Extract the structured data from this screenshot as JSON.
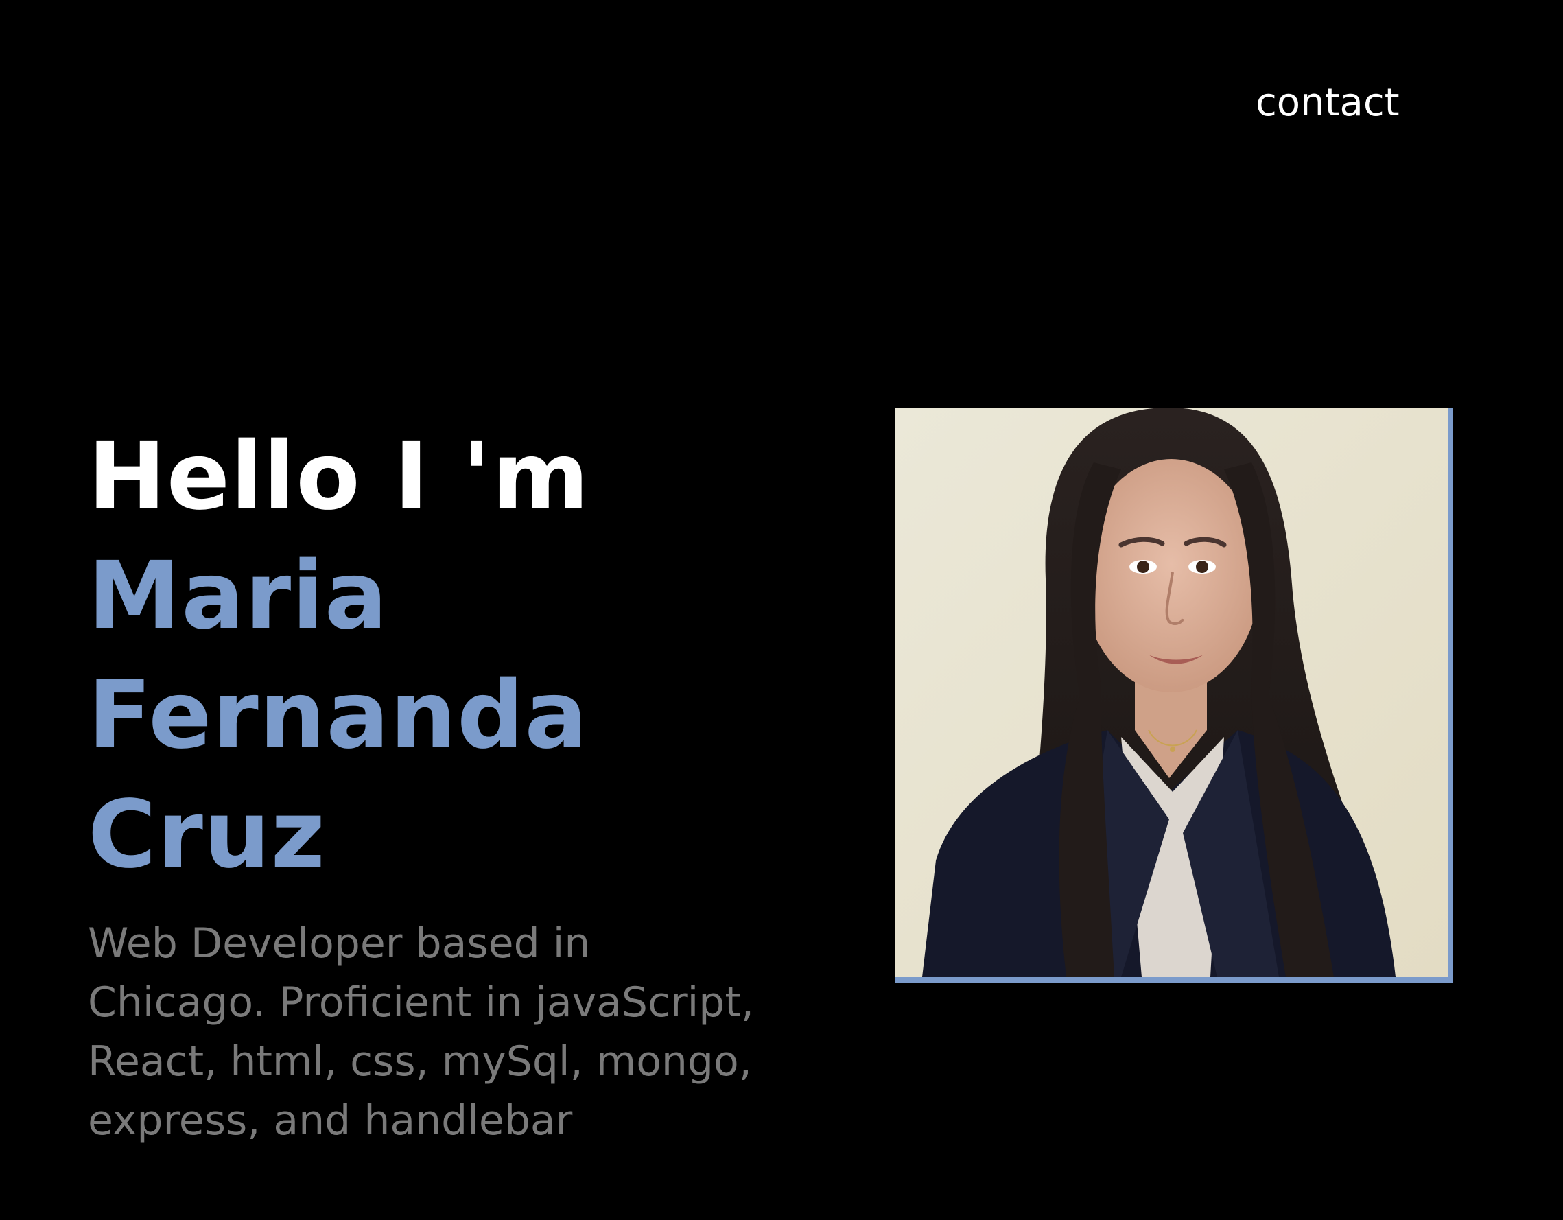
{
  "nav": {
    "contact_label": "contact"
  },
  "hero": {
    "greeting": "Hello I 'm",
    "name_lines": [
      "Maria",
      "Fernanda",
      "Cruz"
    ],
    "bio": "Web Developer based in Chicago. Proficient in javaScript, React, html, css, mySql, mongo, express, and handlebar"
  },
  "colors": {
    "background": "#000000",
    "accent": "#7b9bcb",
    "heading": "#ffffff",
    "bio_text": "#7a7a7a"
  },
  "portrait": {
    "icon": "portrait-photo"
  }
}
